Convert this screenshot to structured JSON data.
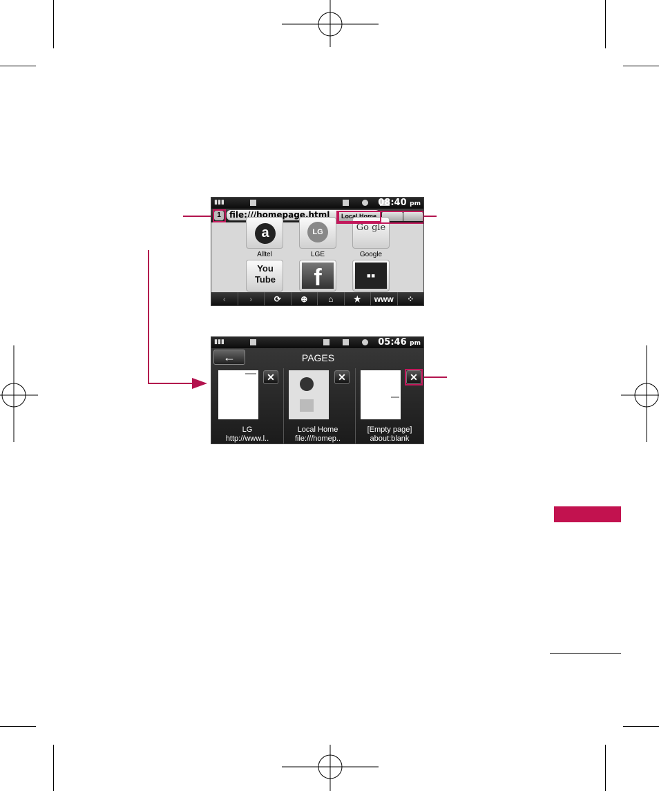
{
  "browser_screen": {
    "status_time": "08:40",
    "status_ampm": "pm",
    "pages_count": "1",
    "url": "file:///homepage.html",
    "active_tab": "Local Home",
    "tiles": [
      {
        "label": "Alltel",
        "icon": "alltel-icon",
        "glyph": "a"
      },
      {
        "label": "LGE",
        "icon": "lge-icon",
        "glyph": "LG"
      },
      {
        "label": "Google",
        "icon": "google-icon",
        "glyph": "Go gle"
      },
      {
        "label": "",
        "icon": "youtube-icon",
        "glyph": "You Tube"
      },
      {
        "label": "",
        "icon": "facebook-icon",
        "glyph": "f"
      },
      {
        "label": "",
        "icon": "myspace-icon",
        "glyph": "▪▪"
      }
    ],
    "toolbar": [
      "‹",
      "›",
      "⟳",
      "⊕",
      "⌂",
      "★",
      "www",
      "⁘"
    ]
  },
  "pages_screen": {
    "status_time": "05:46",
    "status_ampm": "pm",
    "title": "PAGES",
    "back_glyph": "←",
    "close_glyph": "✕",
    "pages": [
      {
        "title": "LG",
        "url": "http://www.l.."
      },
      {
        "title": "Local Home",
        "url": "file:///homep.."
      },
      {
        "title": "[Empty page]",
        "url": "about:blank"
      }
    ]
  },
  "colors": {
    "accent": "#c2185b",
    "section_tab": "#c2124f"
  }
}
